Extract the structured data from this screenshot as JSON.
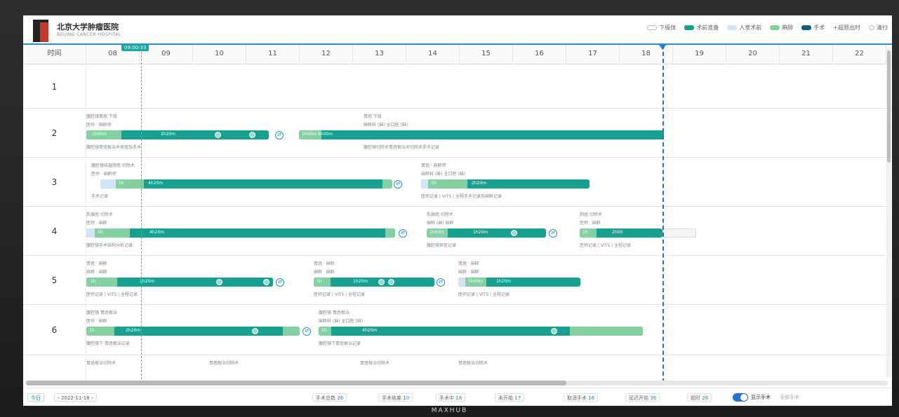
{
  "brand_footer": "MAXHUB",
  "header": {
    "logo_title": "北京大学肿瘤医院",
    "logo_subtitle": "BEIJING CANCER HOSPITAL",
    "legend": [
      {
        "label": "下级体",
        "color": "#ffffff"
      },
      {
        "label": "术前准备",
        "color": "#17a08f"
      },
      {
        "label": "入室术前",
        "color": "#d3e4f5"
      },
      {
        "label": "麻醉",
        "color": "#84d0a2"
      },
      {
        "label": "手术",
        "color": "#14607a"
      },
      {
        "label": "+超限出时",
        "color": "#ffffff"
      },
      {
        "label": "清扫",
        "color": "#ffffff"
      }
    ]
  },
  "timeline": {
    "room_header": "时间",
    "current_time": "09:00:33",
    "hours": [
      "08",
      "09",
      "10",
      "11",
      "12",
      "13",
      "14",
      "15",
      "16",
      "17",
      "18",
      "19",
      "20",
      "21",
      "22"
    ]
  },
  "rows": [
    {
      "num": "1"
    },
    {
      "num": "2",
      "texts": [
        "腹腔镜胃癌 下级",
        "医师 · 麻醉师",
        "1h00m",
        "2h20m",
        "腹腔镜胃癌根治术探查及手术",
        "胃癌 下级",
        "麻醉科 (麻) 全口腔 (麻)",
        "1h00m 6h00m",
        "腹腔镜切除术胃癌根治术切除术手术记录"
      ]
    },
    {
      "num": "3",
      "texts": [
        "腹腔镜结直肠癌 切除术",
        "医师 · 麻醉师",
        "1h",
        "4h20m",
        "手术记录",
        "胃癌 · 麻醉师",
        "麻醉科 (麻) 全口腔 (麻)",
        "1h",
        "2h20m",
        "医师记录 | VITS | 全程手术记录及麻醉记录"
      ]
    },
    {
      "num": "4",
      "texts": [
        "乳腺癌 切除术",
        "医师 · 麻醉",
        "1h",
        "4h20m",
        "腹腔镜手术结构分析记录",
        "乳腺癌 切除术",
        "麻醉 (麻) 麻醉",
        "1h00m",
        "1h20m",
        "腹腔镜探查记录",
        "肺癌 切除术",
        "医师 · 麻醉",
        "1h",
        "2h00",
        "医师记录 | VITS | 全程记录"
      ]
    },
    {
      "num": "5",
      "texts": [
        "胃癌 · 麻醉",
        "麻醉 · 麻醉",
        "1h",
        "2h20m",
        "医师记录 | VITS | 全程记录",
        "胃癌 · 麻醉",
        "麻醉 · 麻醉",
        "1h",
        "1h20m",
        "医师记录 | VITS | 全程记录",
        "胃癌 · 麻醉",
        "麻醉 · 麻醉",
        "1h00m",
        "1h20m",
        "医师记录 | VITS | 全程记录"
      ]
    },
    {
      "num": "6",
      "texts": [
        "腹腔镜 胃癌根治",
        "医师 · 麻醉",
        "1h",
        "2h20m",
        "腹腔镜下 胃癌根治记录",
        "腹腔镜 胃癌根治",
        "麻醉科 (麻) 全口腔 (麻)",
        "1h",
        "4h20m",
        "腹腔镜下胃癌根治记录"
      ]
    },
    {
      "num": "",
      "texts": [
        "胃癌根治切除术",
        "胃癌根治切除术",
        "胃癌根治切除术",
        "胃癌根治切除术"
      ]
    }
  ],
  "footer": {
    "today_btn": "今日",
    "date": "2022-11-16",
    "stats": [
      {
        "label": "手术总数",
        "value": "26"
      },
      {
        "label": "手术结束",
        "value": "10"
      },
      {
        "label": "手术中",
        "value": "18"
      },
      {
        "label": "未开始",
        "value": "17"
      },
      {
        "label": "取消手术",
        "value": "16"
      },
      {
        "label": "延迟开始",
        "value": "36"
      },
      {
        "label": "超时",
        "value": "26"
      }
    ],
    "toggle_label": "显示手术",
    "toggle_sub": "全部手术"
  }
}
